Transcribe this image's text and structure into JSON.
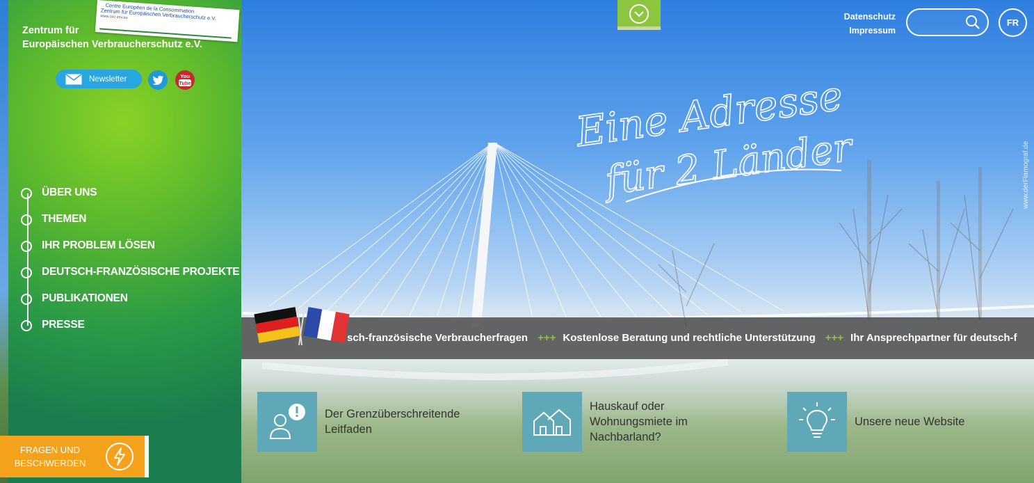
{
  "header": {
    "org_name_line1": "Zentrum für",
    "org_name_line2": "Europäischen Verbraucherschutz e.V.",
    "logo": {
      "line1": "Centre Européen de la Consommation",
      "line2": "Zentrum für Europäischen Verbraucherschutz e.V.",
      "line3": "www.cec-zev.eu"
    },
    "newsletter_label": "Newsletter",
    "youtube_label": "You Tube",
    "links": [
      "Datenschutz",
      "Impressum"
    ],
    "search_placeholder": "",
    "lang_label": "FR"
  },
  "nav": {
    "items": [
      {
        "label": "ÜBER UNS"
      },
      {
        "label": "THEMEN"
      },
      {
        "label": "IHR PROBLEM LÖSEN"
      },
      {
        "label": "DEUTSCH-FRANZÖSISCHE PROJEKTE"
      },
      {
        "label": "PUBLIKATIONEN"
      },
      {
        "label": "PRESSE"
      }
    ]
  },
  "cta": {
    "line1": "FRAGEN UND",
    "line2": "BESCHWERDEN"
  },
  "hero": {
    "slogan_line1": "Eine Adresse",
    "slogan_line2": "für 2 Länder",
    "credit": "www.derFlamograf.de"
  },
  "ticker": {
    "items": [
      "sch-französische Verbraucherfragen",
      "Kostenlose Beratung und rechtliche Unterstützung",
      "Ihr Ansprechpartner für deutsch-f"
    ],
    "separator": "+++"
  },
  "tiles": [
    {
      "icon": "person-exclamation-icon",
      "label_line1": "Der Grenzüberschreitende",
      "label_line2": "Leitfaden",
      "label_line3": ""
    },
    {
      "icon": "houses-icon",
      "label_line1": "Hauskauf oder",
      "label_line2": "Wohnungsmiete im",
      "label_line3": "Nachbarland?"
    },
    {
      "icon": "lightbulb-icon",
      "label_line1": "Unsere neue Website",
      "label_line2": "",
      "label_line3": ""
    }
  ],
  "colors": {
    "sidebar_green": "#2a9a47",
    "accent_green": "#8cc63f",
    "cta_orange": "#f4a21b",
    "tile_teal": "#5fa8b8",
    "newsletter_blue": "#29a6e0"
  }
}
